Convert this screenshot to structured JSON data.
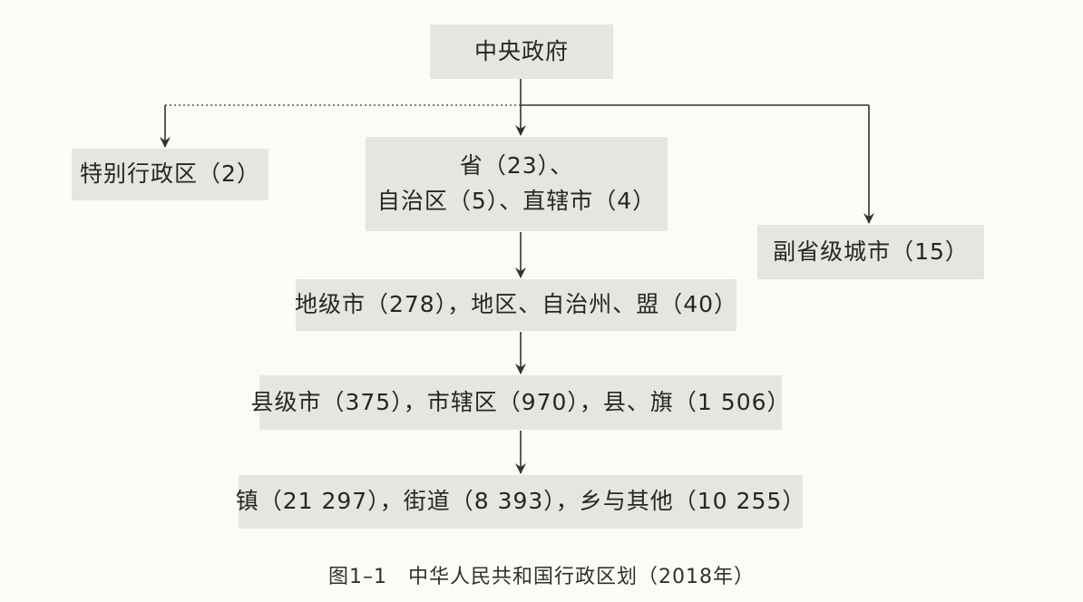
{
  "nodes": {
    "central": "中央政府",
    "sar": "特别行政区（2）",
    "province_line1": "省（23）、",
    "province_line2": "自治区（5）、直辖市（4）",
    "sub_provincial": "副省级城市（15）",
    "prefecture": "地级市（278），地区、自治州、盟（40）",
    "county": "县级市（375），市辖区（970），县、旗（1 506）",
    "township": "镇（21 297），街道（8 393），乡与其他（10 255）"
  },
  "caption": "图1–1　中华人民共和国行政区划（2018年）",
  "colors": {
    "background": "#fcfbf5",
    "box_fill": "#e6e5e0",
    "line": "#333333"
  }
}
